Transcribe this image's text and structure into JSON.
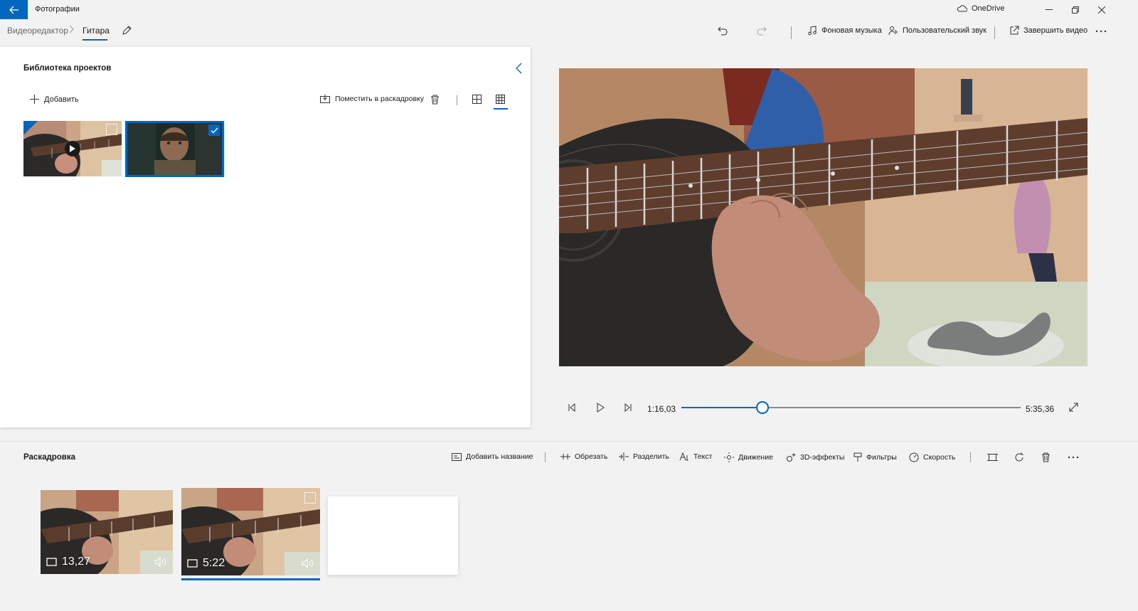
{
  "app": {
    "title": "Фотографии",
    "onedrive": "OneDrive"
  },
  "breadcrumb": {
    "root": "Видеоредактор",
    "current": "Гитара"
  },
  "toolbar": {
    "background_music": "Фоновая музыка",
    "custom_audio": "Пользовательский звук",
    "finish_video": "Завершить видео"
  },
  "library": {
    "title": "Библиотека проектов",
    "add_label": "Добавить",
    "place_label": "Поместить в раскадровку",
    "items": [
      {
        "kind": "video",
        "state": "in-storyboard",
        "selected": false
      },
      {
        "kind": "video",
        "state": "selected",
        "selected": true
      }
    ]
  },
  "player": {
    "current_time": "1:16,03",
    "total_time": "5:35,36",
    "progress": 0.239
  },
  "storyboard": {
    "title": "Раскадровка",
    "actions": {
      "add_title": "Добавить название",
      "trim": "Обрезать",
      "split": "Разделить",
      "text": "Текст",
      "motion": "Движение",
      "effects_3d": "3D-эффекты",
      "filters": "Фильтры",
      "speed": "Скорость"
    },
    "clips": [
      {
        "duration": "13,27",
        "selected": false
      },
      {
        "duration": "5:22",
        "selected": true
      }
    ]
  },
  "colors": {
    "accent": "#0067c0",
    "panel": "#ffffff",
    "background": "#f2f2f2"
  }
}
